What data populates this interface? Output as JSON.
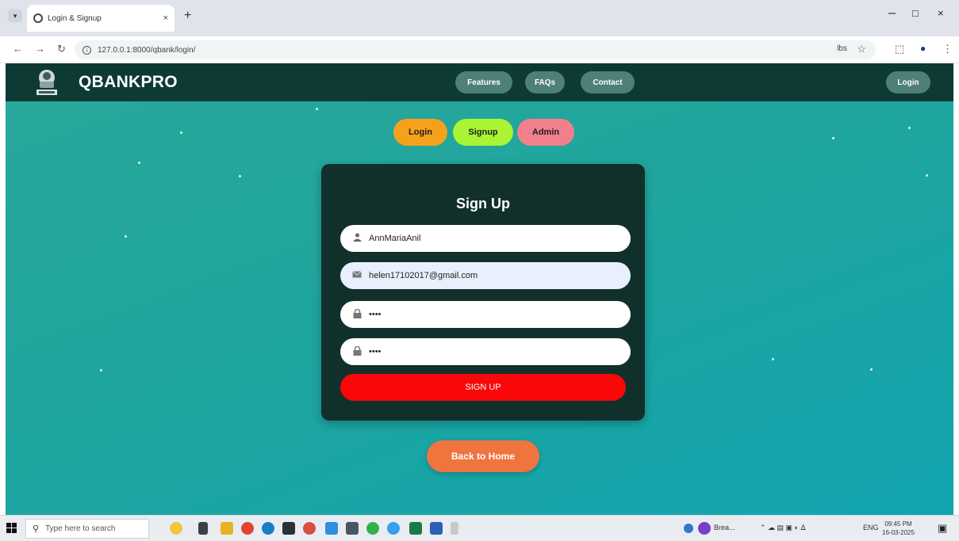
{
  "browser": {
    "tab_title": "Login & Signup",
    "tab_close": "×",
    "new_tab": "+",
    "url": "127.0.0.1:8000/qbank/login/",
    "nav_back": "←",
    "nav_forward": "→",
    "nav_reload": "↻",
    "translate": "lbs",
    "window_min": "–",
    "window_max": "□",
    "window_close": "×"
  },
  "site": {
    "brand": "QBANKPRO",
    "nav": {
      "features": "Features",
      "faqs": "FAQs",
      "contact": "Contact",
      "login": "Login"
    }
  },
  "toggles": {
    "login": "Login",
    "signup": "Signup",
    "admin": "Admin"
  },
  "form": {
    "title": "Sign Up",
    "username_value": "AnnMariaAnil",
    "email_value": "helen17102017@gmail.com",
    "password_value": "••••",
    "confirm_value": "••••",
    "submit_label": "SIGN UP"
  },
  "back_home": "Back to Home",
  "taskbar": {
    "search_placeholder": "Type here to search",
    "weather_text": "Brea...",
    "lang": "ENG",
    "time": "09:45 PM",
    "date": "16-03-2025"
  },
  "colors": {
    "nav_bg": "#0e3a36",
    "card_bg": "#11302c",
    "login_toggle": "#f5a11c",
    "signup_toggle": "#a9f533",
    "admin_toggle": "#f27f8c",
    "submit": "#f80808",
    "back_home": "#f0743e"
  }
}
